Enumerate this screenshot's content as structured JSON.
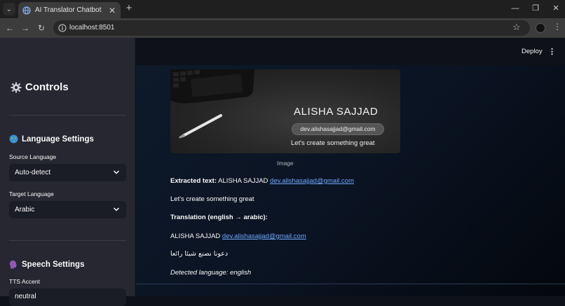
{
  "browser": {
    "tab_title": "AI Translator Chatbot",
    "url": "localhost:8501"
  },
  "sidebar": {
    "title": "Controls",
    "language_settings": {
      "heading": "Language Settings",
      "source_label": "Source Language",
      "source_value": "Auto-detect",
      "target_label": "Target Language",
      "target_value": "Arabic"
    },
    "speech_settings": {
      "heading": "Speech Settings",
      "tts_label": "TTS Accent",
      "tts_value": "neutral"
    }
  },
  "header": {
    "deploy_label": "Deploy"
  },
  "image": {
    "name": "ALISHA SAJJAD",
    "email": "dev.alishasajjad@gmail.com",
    "tagline": "Let's create something great",
    "caption": "Image"
  },
  "extraction": {
    "extracted_label": "Extracted text:",
    "extracted_name": "ALISHA SAJJAD",
    "extracted_email": "dev.alishasajjad@gmail.com",
    "extracted_tagline": "Let's create something great",
    "translation_label": "Translation (english → arabic):",
    "translation_name": "ALISHA SAJJAD",
    "translation_email": "dev.alishasajjad@gmail.com",
    "translation_arabic": "دعونا نصنع شيئا رائعا",
    "detected": "Detected language: english"
  },
  "colors": {
    "sidebar_bg": "#262730",
    "app_bg": "#0e1117",
    "link": "#6fa8ff"
  }
}
